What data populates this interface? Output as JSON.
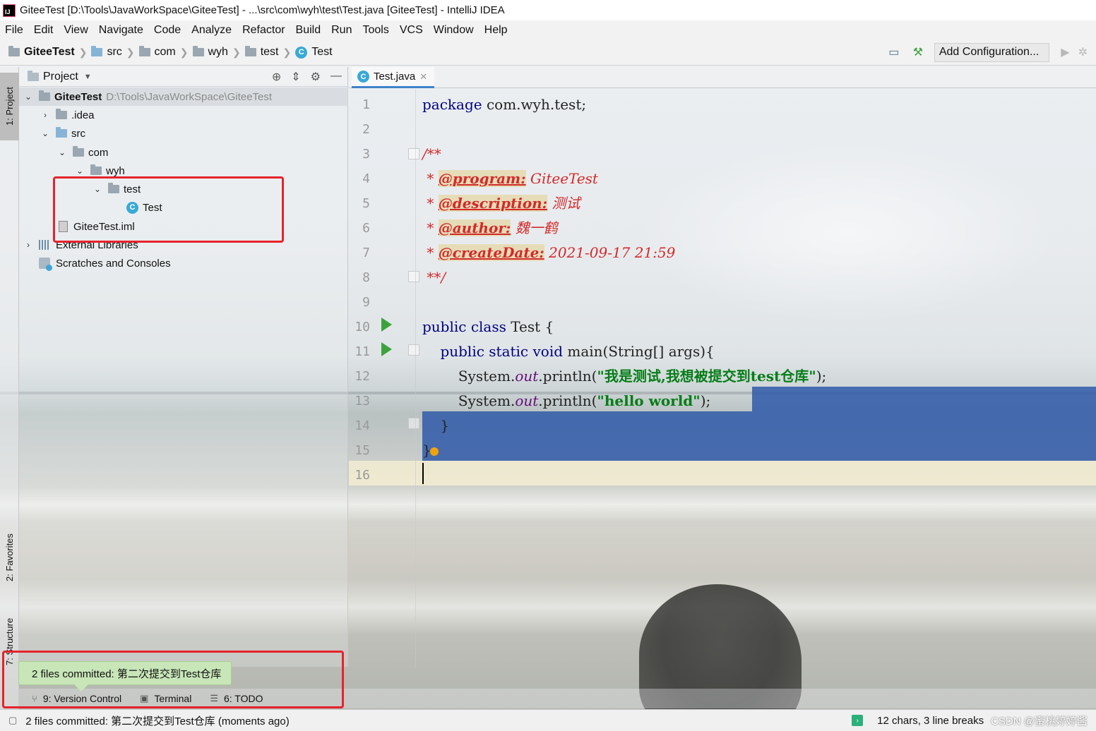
{
  "window": {
    "title": "GiteeTest [D:\\Tools\\JavaWorkSpace\\GiteeTest] - ...\\src\\com\\wyh\\test\\Test.java [GiteeTest] - IntelliJ IDEA"
  },
  "menu": [
    "File",
    "Edit",
    "View",
    "Navigate",
    "Code",
    "Analyze",
    "Refactor",
    "Build",
    "Run",
    "Tools",
    "VCS",
    "Window",
    "Help"
  ],
  "breadcrumb": {
    "project": "GiteeTest",
    "src": "src",
    "com": "com",
    "wyh": "wyh",
    "test": "test",
    "file": "Test"
  },
  "toolbar": {
    "add_config": "Add Configuration..."
  },
  "left_strip": {
    "project_tab": "1: Project",
    "favorites_tab": "2: Favorites",
    "structure_tab": "7: Structure"
  },
  "project_panel": {
    "title": "Project",
    "root_name": "GiteeTest",
    "root_path": "D:\\Tools\\JavaWorkSpace\\GiteeTest",
    "idea": ".idea",
    "src": "src",
    "com": "com",
    "wyh": "wyh",
    "test": "test",
    "test_class": "Test",
    "iml": "GiteeTest.iml",
    "ext_libs": "External Libraries",
    "scratches": "Scratches and Consoles"
  },
  "editor": {
    "tab_label": "Test.java",
    "line_numbers": [
      "1",
      "2",
      "3",
      "4",
      "5",
      "6",
      "7",
      "8",
      "9",
      "10",
      "11",
      "12",
      "13",
      "14",
      "15",
      "16"
    ],
    "code": {
      "l1_kw": "package",
      "l1_rest": " com.wyh.test;",
      "l3": "/**",
      "l4_star": " * ",
      "l4_tag": "@program:",
      "l4_val": " GiteeTest",
      "l5_star": " * ",
      "l5_tag": "@description:",
      "l5_val": " 测试",
      "l6_star": " * ",
      "l6_tag": "@author:",
      "l6_val": " 魏一鹤",
      "l7_star": " * ",
      "l7_tag": "@createDate:",
      "l7_val": " 2021-09-17 21:59",
      "l8": " **/",
      "l10_kw": "public class",
      "l10_rest": " Test {",
      "l11_indent": "    ",
      "l11_kw": "public static void",
      "l11_rest": " main(String[] args){",
      "l12_pre": "        System.",
      "l12_field": "out",
      "l12_mid": ".println(",
      "l12_str": "\"我是测试,我想被提交到test仓库\"",
      "l12_end": ");",
      "l13_pre": "        System.",
      "l13_field": "out",
      "l13_mid": ".println(",
      "l13_str": "\"hello world\"",
      "l13_end": ");",
      "l14": "    }",
      "l15": "}"
    }
  },
  "bottom_tools": {
    "vcs": "9: Version Control",
    "terminal": "Terminal",
    "todo": "6: TODO"
  },
  "notification": {
    "balloon": "2 files committed: 第二次提交到Test仓库"
  },
  "status": {
    "message": "2 files committed: 第二次提交到Test仓库 (moments ago)",
    "right": "12 chars, 3 line breaks",
    "watermark": "CSDN @蜜桃婷婷酱"
  },
  "colors": {
    "selection": "#2f59a8",
    "keyword": "#000080",
    "doc_comment": "#d22a2a",
    "string": "#067d17",
    "annotation_box": "#e5232c",
    "balloon": "#c8e6b8"
  }
}
